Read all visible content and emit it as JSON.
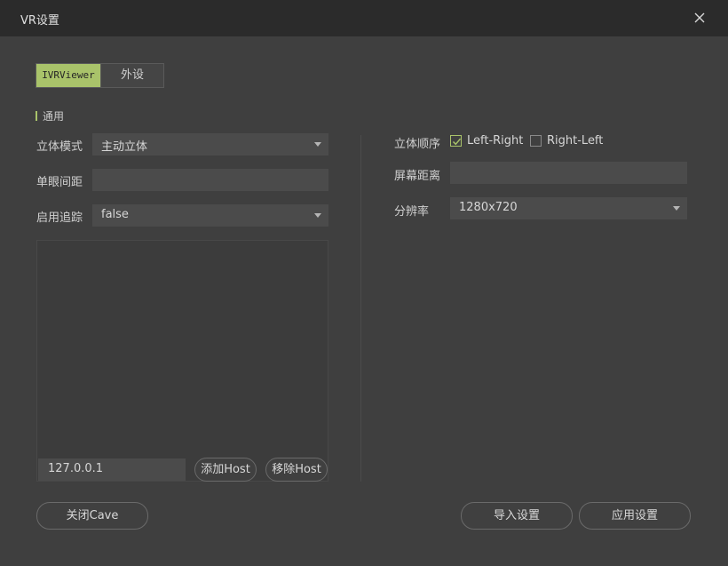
{
  "window": {
    "title": "VR设置"
  },
  "tabs": [
    {
      "label": "IVRViewer",
      "active": true
    },
    {
      "label": "外设",
      "active": false
    }
  ],
  "section": {
    "title": "通用"
  },
  "left": {
    "stereo_mode": {
      "label": "立体模式",
      "value": "主动立体"
    },
    "eye_distance": {
      "label": "单眼间距",
      "value": ""
    },
    "tracking": {
      "label": "启用追踪",
      "value": "false"
    },
    "host_input": {
      "value": "127.0.0.1"
    },
    "add_host": "添加Host",
    "remove_host": "移除Host"
  },
  "right": {
    "stereo_order": {
      "label": "立体顺序",
      "options": [
        {
          "label": "Left-Right",
          "checked": true
        },
        {
          "label": "Right-Left",
          "checked": false
        }
      ]
    },
    "screen_distance": {
      "label": "屏幕距离",
      "value": ""
    },
    "resolution": {
      "label": "分辨率",
      "value": "1280x720"
    }
  },
  "footer": {
    "close_cave": "关闭Cave",
    "import_settings": "导入设置",
    "apply_settings": "应用设置"
  },
  "colors": {
    "accent": "#a9c36a",
    "background": "#3f3f3f",
    "titlebar": "#2b2b2b",
    "field": "#4b4b4b"
  }
}
